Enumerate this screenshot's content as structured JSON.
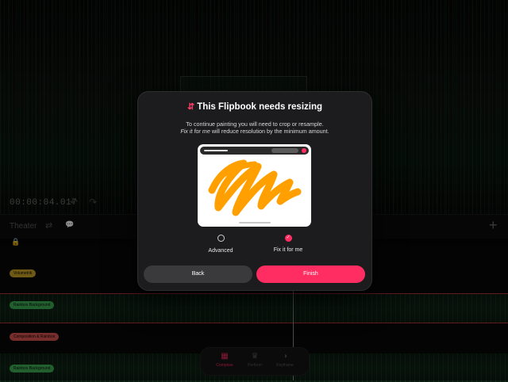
{
  "preview": {
    "timecode": "00:00:04.017",
    "undo_icon": "↶",
    "redo_icon": "↷"
  },
  "toolbar": {
    "theater_label": "Theater",
    "sliders_icon": "⇄",
    "comment_icon": "💬",
    "add_icon": "+",
    "lock_icon": "🔒"
  },
  "timeline": {
    "tracks": [
      {
        "label": "Volumetrik",
        "color": "#c9a227"
      },
      {
        "label": "Rainbox Background",
        "color": "#3fae55"
      },
      {
        "label": "Composition & Rainbox",
        "color": "#d9534f"
      },
      {
        "label": "Rainbox Background",
        "color": "#3fae55"
      }
    ]
  },
  "bottom_nav": {
    "items": [
      {
        "label": "Compose",
        "icon": "▦"
      },
      {
        "label": "Perform",
        "icon": "♛"
      },
      {
        "label": "Keyframe",
        "icon": "◑"
      }
    ]
  },
  "modal": {
    "icon": "⇵",
    "title": "This Flipbook needs resizing",
    "line1": "To continue painting you will need to crop or resample.",
    "line2_emphasis": "Fix it for me",
    "line2_rest": " will reduce resolution by the minimum amount.",
    "options": [
      {
        "label": "Advanced",
        "selected": false
      },
      {
        "label": "Fix it for me",
        "selected": true
      }
    ],
    "check_icon": "✓",
    "back_label": "Back",
    "finish_label": "Finish"
  },
  "colors": {
    "accent": "#ff2d62",
    "scribble": "#ffa000"
  }
}
